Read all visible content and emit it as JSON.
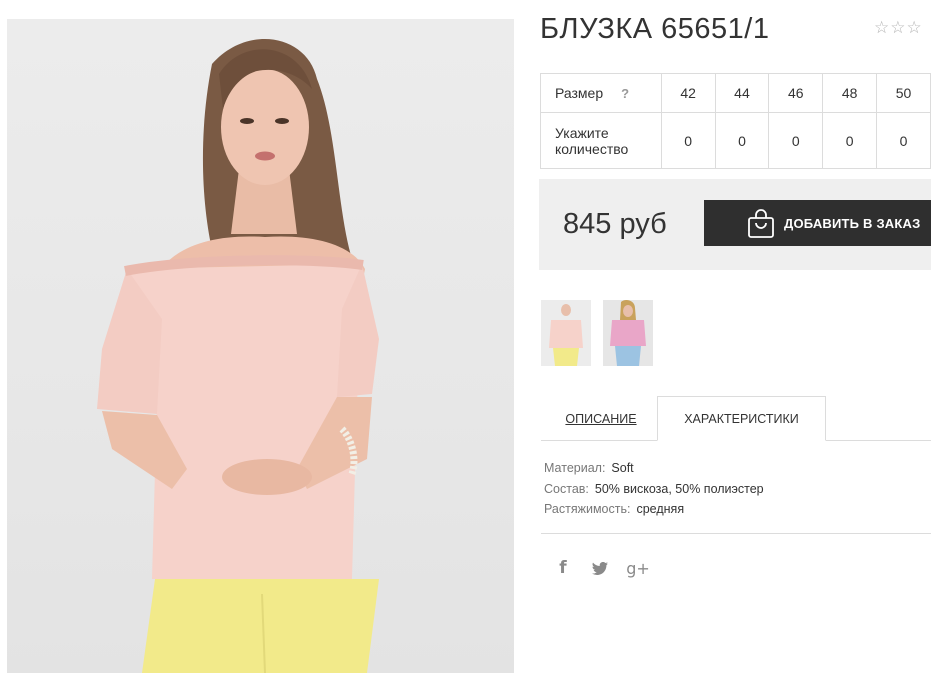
{
  "product": {
    "title": "БЛУЗКА 65651/1",
    "rating_stars": [
      "☆",
      "☆",
      "☆"
    ]
  },
  "size_table": {
    "size_label": "Размер",
    "help_label": "?",
    "sizes": [
      "42",
      "44",
      "46",
      "48",
      "50"
    ],
    "qty_label": "Укажите количество",
    "quantities": [
      "0",
      "0",
      "0",
      "0",
      "0"
    ]
  },
  "price": "845 руб",
  "order_button": "ДОБАВИТЬ В ЗАКАЗ",
  "tabs": [
    "ОПИСАНИЕ",
    "ХАРАКТЕРИСТИКИ"
  ],
  "specs": [
    {
      "key": "Материал:",
      "value": "Soft"
    },
    {
      "key": "Состав:",
      "value": "50% вискоза, 50% полиэстер"
    },
    {
      "key": "Растяжимость:",
      "value": "средняя"
    }
  ],
  "social": {
    "facebook": "f",
    "google_plus": "g+"
  },
  "icons": [
    "shopping-bag-icon",
    "star-icon",
    "facebook-icon",
    "twitter-icon",
    "google-plus-icon"
  ],
  "colors": {
    "button_bg": "#2f2f2f",
    "price_box_bg": "#efefef",
    "blouse": "#f5cfc8",
    "pants": "#f2ea8a"
  }
}
